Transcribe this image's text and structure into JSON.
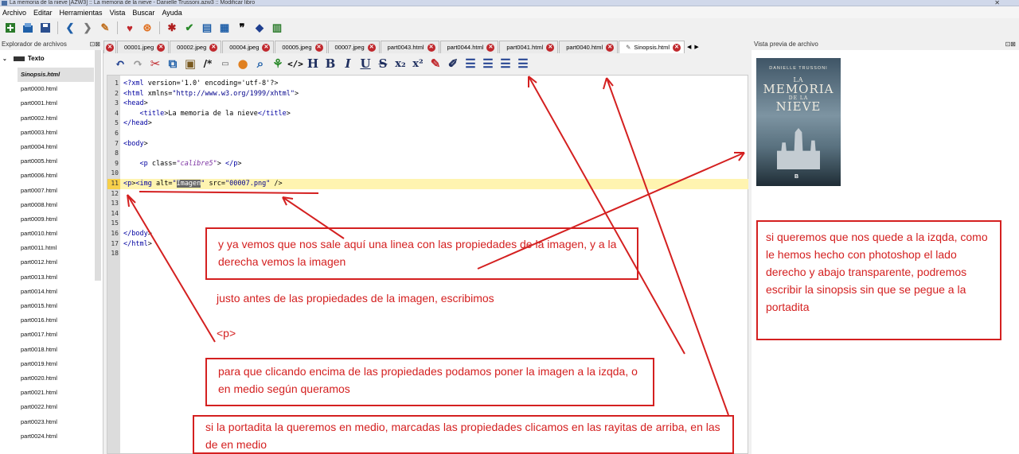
{
  "window": {
    "title": "La memoria de la nieve [AZW3] :: La memoria de la nieve - Danielle Trussoni.azw3 :: Modificar libro",
    "close_glyph": "✕"
  },
  "menu": [
    "Archivo",
    "Editar",
    "Herramientas",
    "Vista",
    "Buscar",
    "Ayuda"
  ],
  "file_explorer": {
    "title": "Explorador de archivos",
    "group": "Texto",
    "selected": "Sinopsis.html",
    "items": [
      "part0000.html",
      "part0001.html",
      "part0002.html",
      "part0003.html",
      "part0004.html",
      "part0005.html",
      "part0006.html",
      "part0007.html",
      "part0008.html",
      "part0009.html",
      "part0010.html",
      "part0011.html",
      "part0012.html",
      "part0013.html",
      "part0014.html",
      "part0015.html",
      "part0016.html",
      "part0017.html",
      "part0018.html",
      "part0019.html",
      "part0020.html",
      "part0021.html",
      "part0022.html",
      "part0023.html",
      "part0024.html"
    ]
  },
  "tabs": [
    "00001.jpeg",
    "00002.jpeg",
    "00004.jpeg",
    "00005.jpeg",
    "00007.jpeg",
    "part0043.html",
    "part0044.html",
    "part0041.html",
    "part0040.html",
    "Sinopsis.html"
  ],
  "active_tab": "Sinopsis.html",
  "tab_nav": {
    "prev": "◀",
    "next": "▶"
  },
  "editor": {
    "lines": [
      {
        "n": "1",
        "code": "<?xml version='1.0' encoding='utf-8'?>"
      },
      {
        "n": "2",
        "code": "<html xmlns=\"http://www.w3.org/1999/xhtml\">"
      },
      {
        "n": "3",
        "code": "<head>"
      },
      {
        "n": "4",
        "code": "    <title>La memoria de la nieve</title>"
      },
      {
        "n": "5",
        "code": "</head>"
      },
      {
        "n": "6",
        "code": ""
      },
      {
        "n": "7",
        "code": "<body>"
      },
      {
        "n": "8",
        "code": ""
      },
      {
        "n": "9",
        "code": "    <p class=\"calibre5\"> </p>"
      },
      {
        "n": "10",
        "code": ""
      },
      {
        "n": "11",
        "code": "<p><img alt=\"Imagen\" src=\"00007.png\" />"
      },
      {
        "n": "12",
        "code": ""
      },
      {
        "n": "13",
        "code": ""
      },
      {
        "n": "14",
        "code": ""
      },
      {
        "n": "15",
        "code": ""
      },
      {
        "n": "16",
        "code": "</body>"
      },
      {
        "n": "17",
        "code": "</html>"
      },
      {
        "n": "18",
        "code": ""
      }
    ],
    "highlighted_line": "11"
  },
  "preview": {
    "title": "Vista previa de archivo",
    "cover_author": "DANIELLE TRUSSONI",
    "cover_title_1": "LA",
    "cover_title_2": "MEMORIA",
    "cover_title_3": "DE LA",
    "cover_title_4": "NIEVE",
    "cover_logo": "B"
  },
  "annotations": {
    "a1": "y ya vemos que nos sale aquí una linea con las propiedades de la imagen, y a la derecha vemos la imagen",
    "a2": "justo antes de las propiedades de la imagen, escribimos",
    "a3": "<p>",
    "a4": "para que clicando encima de las propiedades podamos poner la imagen a la izqda, o en medio según queramos",
    "a5": "si la portadita la queremos en medio, marcadas las propiedades clicamos en las rayitas de arriba, en las de en medio",
    "a6": "si queremos que nos quede a la izqda, como le hemos hecho con photoshop el lado derecho y abajo transparente, podremos escribir la sinopsis sin que se pegue a la portadita"
  },
  "colors": {
    "annotation": "#d42020",
    "highlight": "#fff4b0"
  }
}
